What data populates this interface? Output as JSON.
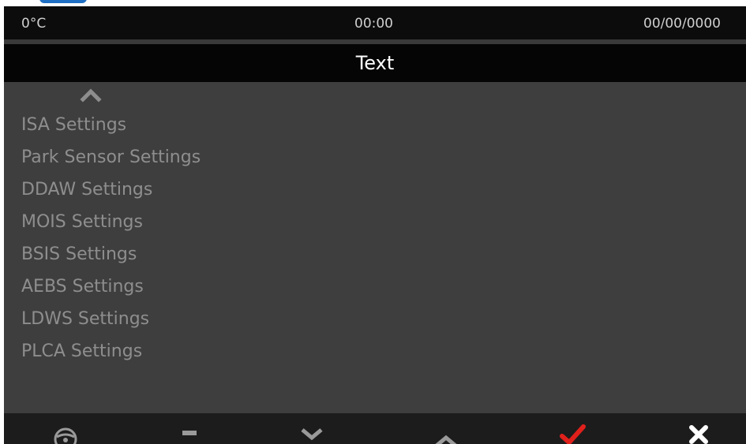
{
  "status_bar": {
    "temperature": "0°C",
    "time": "00:00",
    "date": "00/00/0000"
  },
  "screen_title": "Text",
  "menu": {
    "items": [
      "ISA Settings",
      "Park Sensor Settings",
      "DDAW Settings",
      "MOIS Settings",
      "BSIS Settings",
      "AEBS Settings",
      "LDWS Settings",
      "PLCA Settings"
    ]
  },
  "toolbar": {
    "buttons": [
      "steering-wheel-icon",
      "minus-icon",
      "chevron-down-icon",
      "chevron-up-icon",
      "check-icon",
      "close-icon"
    ]
  },
  "colors": {
    "accent": "#1f6fc4",
    "check": "#e0201b",
    "menu_text": "#8e8e8e",
    "menu_background": "#3e3e3e"
  }
}
